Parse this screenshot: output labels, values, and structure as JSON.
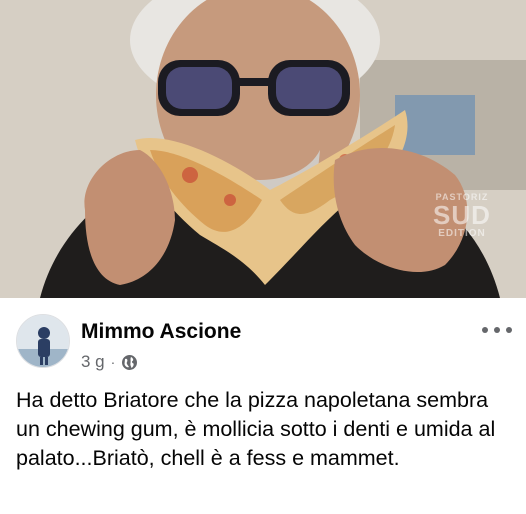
{
  "photo": {
    "alt": "",
    "watermark": {
      "line1": "PASTORIZ",
      "line2": "SUD",
      "line3": "EDITION"
    }
  },
  "post": {
    "author": "Mimmo Ascione",
    "time": "3 g",
    "separator": "·",
    "privacy_icon": "globe-icon",
    "more_icon": "ellipsis-icon",
    "text": "Ha detto Briatore che la pizza napoletana sembra un chewing gum, è mollicia sotto i denti e umida al palato...Briatò, chell è a fess e mammet."
  },
  "colors": {
    "name": "#050505",
    "meta": "#65676b",
    "background": "#ffffff"
  }
}
